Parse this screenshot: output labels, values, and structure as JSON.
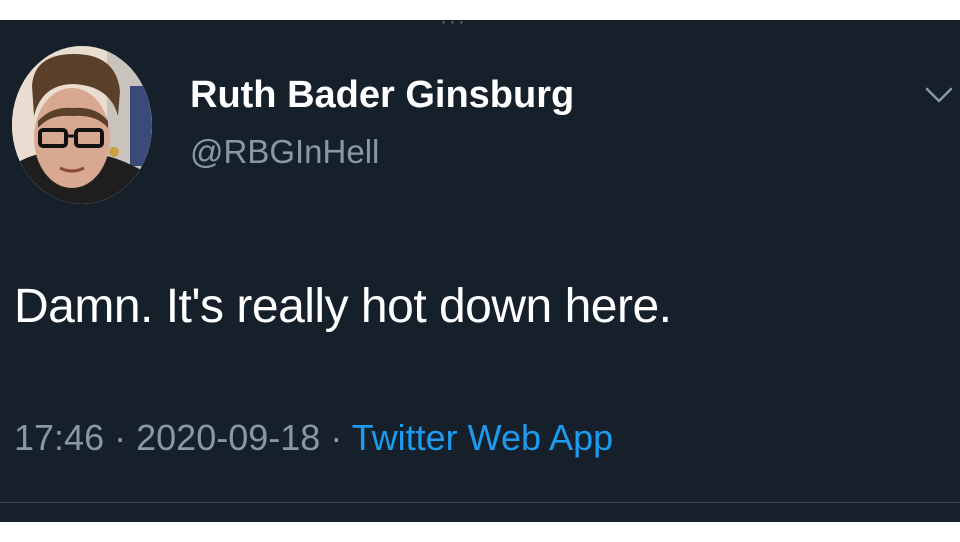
{
  "tweet": {
    "author_name": "Ruth Bader Ginsburg",
    "author_handle": "@RBGInHell",
    "text": "Damn. It's really hot down here.",
    "time": "17:46",
    "separator": "·",
    "date": "2020-09-18",
    "source": "Twitter Web App"
  },
  "icons": {
    "menu": "chevron-down-icon",
    "avatar": "profile-photo"
  },
  "colors": {
    "background": "#15202b",
    "primary_text": "#ffffff",
    "secondary_text": "#8899a6",
    "link": "#1d9bf0",
    "divider": "#38444d"
  }
}
